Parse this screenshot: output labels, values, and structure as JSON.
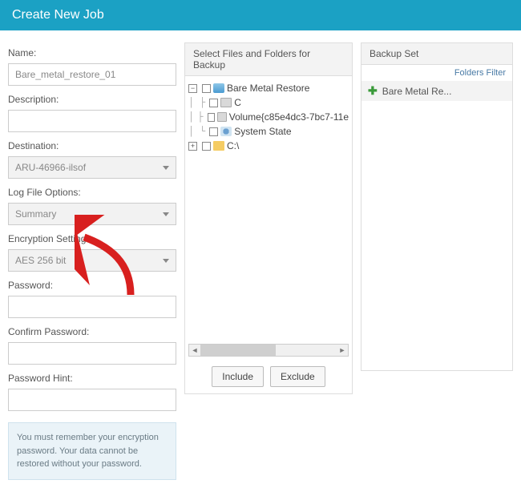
{
  "header": {
    "title": "Create New Job"
  },
  "form": {
    "name_label": "Name:",
    "name_value": "Bare_metal_restore_01",
    "description_label": "Description:",
    "description_value": "",
    "destination_label": "Destination:",
    "destination_value": "ARU-46966-ilsof",
    "logfile_label": "Log File Options:",
    "logfile_value": "Summary",
    "encryption_label": "Encryption Settings:",
    "encryption_value": "AES 256 bit",
    "password_label": "Password:",
    "password_value": "",
    "confirm_label": "Confirm Password:",
    "confirm_value": "",
    "hint_label": "Password Hint:",
    "hint_value": "",
    "note": "You must remember your encryption password. Your data cannot be restored without your password."
  },
  "tree": {
    "header": "Select Files and Folders for Backup",
    "items": [
      {
        "label": "Bare Metal Restore",
        "icon": "computer"
      },
      {
        "label": "C",
        "icon": "drive"
      },
      {
        "label": "Volume{c85e4dc3-7bc7-11e",
        "icon": "drive"
      },
      {
        "label": "System State",
        "icon": "gear"
      },
      {
        "label": "C:\\",
        "icon": "folder"
      }
    ],
    "include_label": "Include",
    "exclude_label": "Exclude"
  },
  "backup_set": {
    "header": "Backup Set",
    "filter_link": "Folders Filter",
    "item": "Bare Metal Re..."
  }
}
